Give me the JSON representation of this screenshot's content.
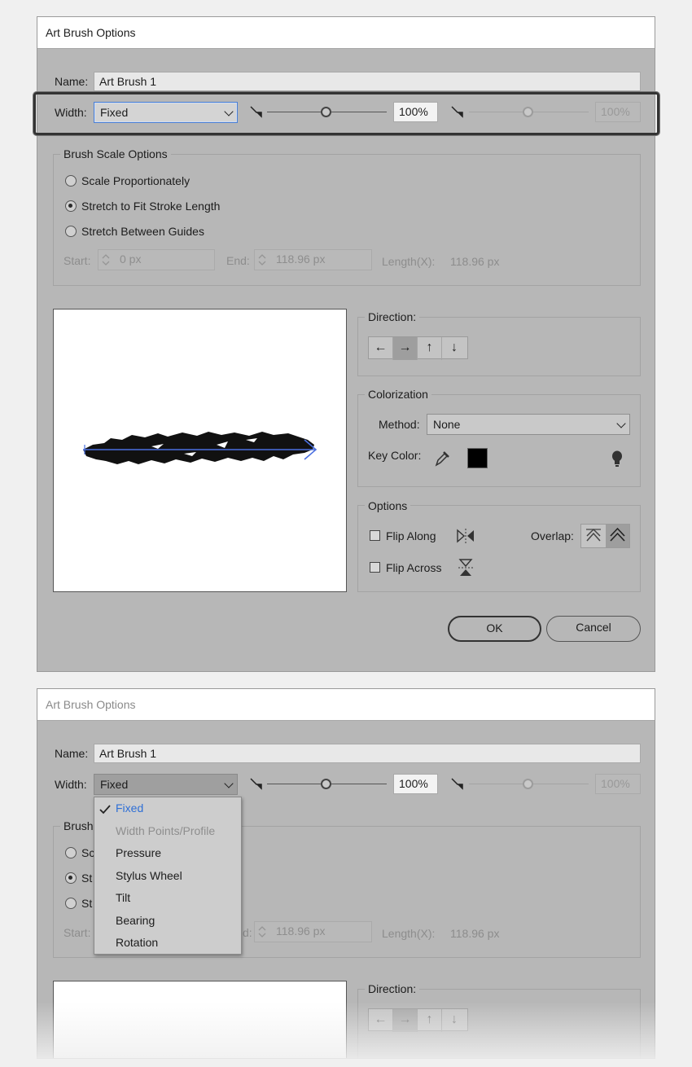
{
  "dialog1": {
    "title": "Art Brush Options",
    "name_label": "Name:",
    "name_value": "Art Brush 1",
    "width_label": "Width:",
    "width_value": "Fixed",
    "width_percent": "100%",
    "variation_percent": "100%",
    "brush_scale": {
      "title": "Brush Scale Options",
      "options": [
        "Scale Proportionately",
        "Stretch to Fit Stroke Length",
        "Stretch Between Guides"
      ],
      "selected": "Stretch to Fit Stroke Length",
      "start_label": "Start:",
      "start_value": "0 px",
      "end_label": "End:",
      "end_value": "118.96 px",
      "length_label": "Length(X):",
      "length_value": "118.96 px"
    },
    "direction": {
      "title": "Direction:",
      "buttons": [
        "←",
        "→",
        "↑",
        "↓"
      ],
      "selected": "→"
    },
    "colorization": {
      "title": "Colorization",
      "method_label": "Method:",
      "method_value": "None",
      "key_color_label": "Key Color:",
      "key_color": "#000000"
    },
    "options": {
      "title": "Options",
      "flip_along": "Flip Along",
      "flip_across": "Flip Across",
      "overlap_label": "Overlap:"
    },
    "ok_label": "OK",
    "cancel_label": "Cancel"
  },
  "dialog2": {
    "title": "Art Brush Options",
    "name_label": "Name:",
    "name_value": "Art Brush 1",
    "width_label": "Width:",
    "width_value": "Fixed",
    "width_percent": "100%",
    "variation_percent": "100%",
    "brush_scale_title_partial": "Brush",
    "radio_partials": [
      "Sc",
      "St",
      "St"
    ],
    "start_label": "Start:",
    "end_label_partial": "d:",
    "end_value": "118.96 px",
    "length_label": "Length(X):",
    "length_value": "118.96 px",
    "direction_title": "Direction:",
    "direction_buttons": [
      "←",
      "→",
      "↑",
      "↓"
    ],
    "width_menu": {
      "items": [
        {
          "label": "Fixed",
          "state": "checked"
        },
        {
          "label": "Width Points/Profile",
          "state": "disabled"
        },
        {
          "label": "Pressure",
          "state": "normal"
        },
        {
          "label": "Stylus Wheel",
          "state": "normal"
        },
        {
          "label": "Tilt",
          "state": "normal"
        },
        {
          "label": "Bearing",
          "state": "normal"
        },
        {
          "label": "Rotation",
          "state": "normal"
        }
      ]
    }
  },
  "colors": {
    "dialog_bg": "#b7b7b7",
    "focus_blue": "#4a7fd4",
    "menu_selected_text": "#2f6fd6",
    "arrow_blue": "#4a6fe0"
  }
}
